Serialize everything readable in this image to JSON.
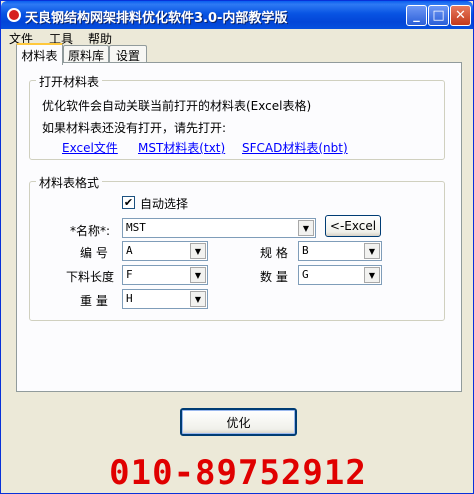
{
  "window": {
    "title": "天良钢结构网架排料优化软件3.0-内部教学版"
  },
  "titlebar_buttons": {
    "minimize": "_",
    "maximize": "□",
    "close": "✕"
  },
  "menu": [
    "文件",
    "工具",
    "帮助"
  ],
  "tabs": [
    "材料表",
    "原料库",
    "设置"
  ],
  "open_group": {
    "title": "打开材料表",
    "line1": "优化软件会自动关联当前打开的材料表(Excel表格)",
    "line2": "如果材料表还没有打开，请先打开:",
    "links": [
      "Excel文件",
      "MST材料表(txt)",
      "SFCAD材料表(nbt)"
    ]
  },
  "format_group": {
    "title": "材料表格式",
    "auto_select": {
      "label": "自动选择",
      "checked": true
    },
    "name_label": "*名称*:",
    "name_value": "MST",
    "excel_button": "<-Excel",
    "fields": {
      "number": {
        "label": "编  号",
        "value": "A"
      },
      "spec": {
        "label": "规  格",
        "value": "B"
      },
      "cut_length": {
        "label": "下料长度",
        "value": "F"
      },
      "quantity": {
        "label": "数  量",
        "value": "G"
      },
      "weight": {
        "label": "重  量",
        "value": "H"
      }
    }
  },
  "optimize_button": "优化",
  "phone": "010-89752912"
}
